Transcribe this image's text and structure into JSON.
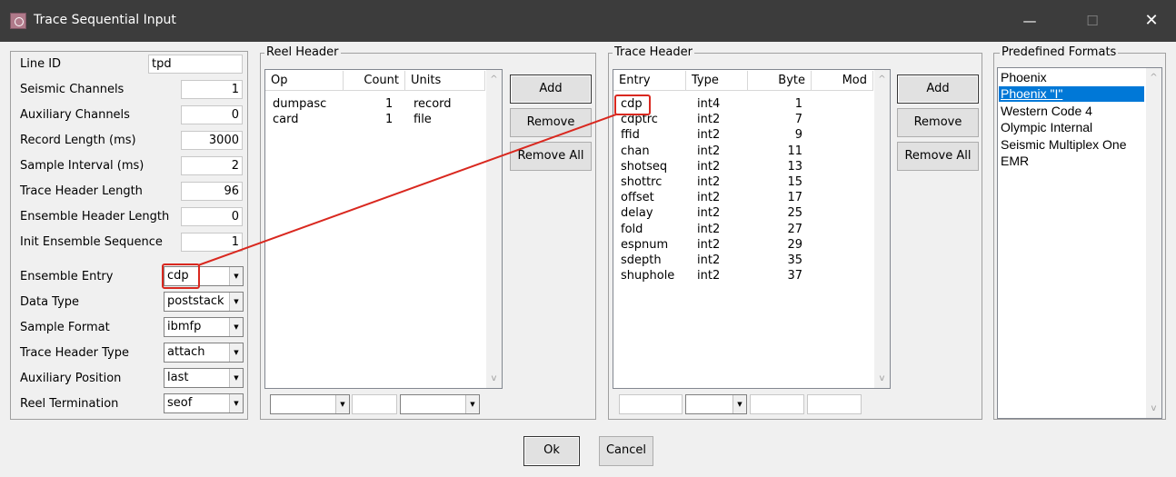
{
  "window": {
    "title": "Trace Sequential Input",
    "minimize_glyph": "—",
    "maximize_glyph": "☐",
    "close_glyph": "✕"
  },
  "params": [
    {
      "label": "Line ID",
      "value": "tpd"
    },
    {
      "label": "Seismic Channels",
      "value": "1"
    },
    {
      "label": "Auxiliary Channels",
      "value": "0"
    },
    {
      "label": "Record Length (ms)",
      "value": "3000"
    },
    {
      "label": "Sample Interval (ms)",
      "value": "2"
    },
    {
      "label": "Trace Header Length",
      "value": "96"
    },
    {
      "label": "Ensemble Header Length",
      "value": "0"
    },
    {
      "label": "Init Ensemble Sequence",
      "value": "1"
    }
  ],
  "options": [
    {
      "label": "Ensemble Entry",
      "value": "cdp"
    },
    {
      "label": "Data Type",
      "value": "poststack"
    },
    {
      "label": "Sample Format",
      "value": "ibmfp"
    },
    {
      "label": "Trace Header Type",
      "value": "attach"
    },
    {
      "label": "Auxiliary Position",
      "value": "last"
    },
    {
      "label": "Reel Termination",
      "value": "seof"
    }
  ],
  "reel_header": {
    "title": "Reel Header",
    "columns": [
      "Op",
      "Count",
      "Units"
    ],
    "rows": [
      [
        "dumpasc",
        "1",
        "record"
      ],
      [
        "card",
        "1",
        "file"
      ]
    ],
    "buttons": {
      "add": "Add",
      "remove": "Remove",
      "remove_all": "Remove All"
    }
  },
  "trace_header": {
    "title": "Trace Header",
    "columns": [
      "Entry",
      "Type",
      "Byte",
      "Mod"
    ],
    "rows": [
      [
        "cdp",
        "int4",
        "1"
      ],
      [
        "cdptrc",
        "int2",
        "7"
      ],
      [
        "ffid",
        "int2",
        "9"
      ],
      [
        "chan",
        "int2",
        "11"
      ],
      [
        "shotseq",
        "int2",
        "13"
      ],
      [
        "shottrc",
        "int2",
        "15"
      ],
      [
        "offset",
        "int2",
        "17"
      ],
      [
        "delay",
        "int2",
        "25"
      ],
      [
        "fold",
        "int2",
        "27"
      ],
      [
        "espnum",
        "int2",
        "29"
      ],
      [
        "sdepth",
        "int2",
        "35"
      ],
      [
        "shuphole",
        "int2",
        "37"
      ]
    ],
    "buttons": {
      "add": "Add",
      "remove": "Remove",
      "remove_all": "Remove All"
    }
  },
  "predefined_formats": {
    "title": "Predefined Formats",
    "items": [
      "Phoenix",
      "Phoenix \"I\"",
      "Western Code 4",
      "Olympic Internal",
      "Seismic Multiplex One",
      "EMR"
    ],
    "selected": "Phoenix \"I\""
  },
  "footer": {
    "ok": "Ok",
    "cancel": "Cancel"
  },
  "colors": {
    "titlebar": "#3c3c3c",
    "selection": "#0078d7",
    "annotation": "#d9281f"
  },
  "icons": {
    "scroll_up": "^",
    "scroll_down": "v",
    "combo_arrow": "▼"
  }
}
